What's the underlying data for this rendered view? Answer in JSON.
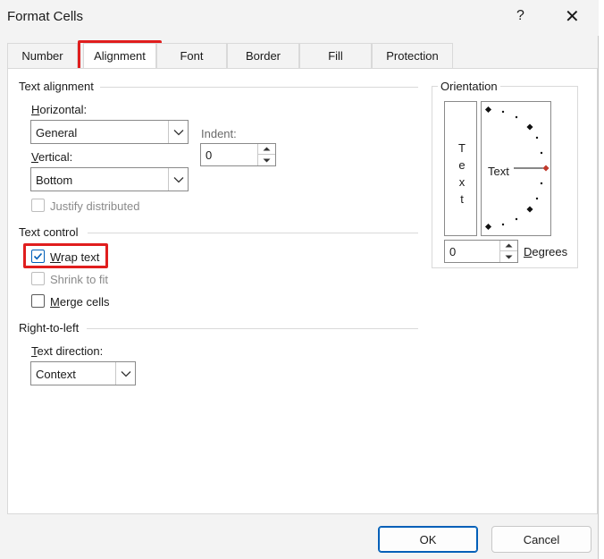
{
  "dialog": {
    "title": "Format Cells",
    "help": "?",
    "close": "✕"
  },
  "tabs": [
    "Number",
    "Alignment",
    "Font",
    "Border",
    "Fill",
    "Protection"
  ],
  "text_alignment": {
    "section_title": "Text alignment",
    "horizontal_label_u": "H",
    "horizontal_label_rest": "orizontal:",
    "horizontal_value": "General",
    "vertical_label_u": "V",
    "vertical_label_rest": "ertical:",
    "vertical_value": "Bottom",
    "indent_label": "Indent:",
    "indent_value": "0",
    "justify_distributed": "Justify distributed"
  },
  "text_control": {
    "section_title": "Text control",
    "wrap_text_u": "W",
    "wrap_text_rest": "rap text",
    "wrap_text_checked": true,
    "shrink_to_fit": "Shrink to fit",
    "merge_cells_u": "M",
    "merge_cells_rest": "erge cells"
  },
  "right_to_left": {
    "section_title": "Right-to-left",
    "text_direction_label_u": "T",
    "text_direction_label_rest": "ext direction:",
    "text_direction_value": "Context"
  },
  "orientation": {
    "section_title": "Orientation",
    "vertical_text": [
      "T",
      "e",
      "x",
      "t"
    ],
    "dial_text": "Text",
    "degrees_value": "0",
    "degrees_label_u": "D",
    "degrees_label_rest": "egrees"
  },
  "buttons": {
    "ok": "OK",
    "cancel": "Cancel"
  },
  "colors": {
    "highlight": "#e01e1e",
    "accent": "#005fb8",
    "dial_marker": "#c0392b"
  }
}
